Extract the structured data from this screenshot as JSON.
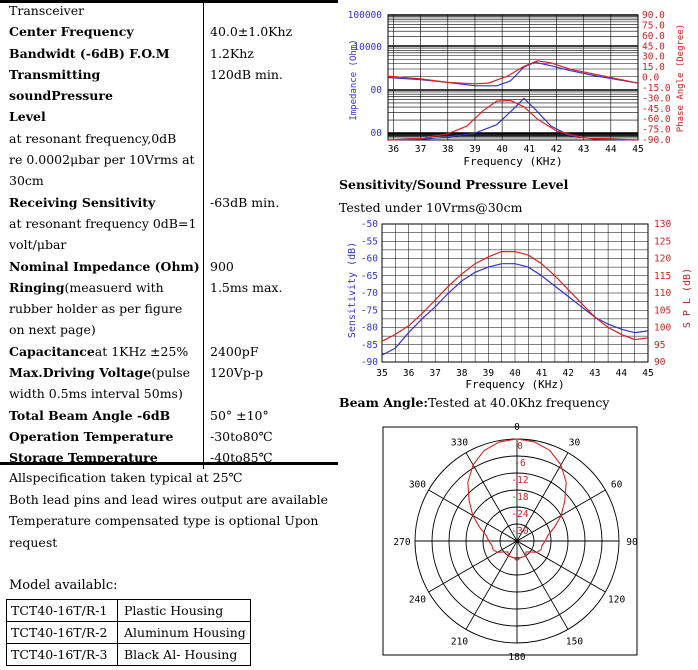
{
  "spec": {
    "rows": [
      {
        "k": "Transceiver",
        "kb": false,
        "v": "",
        "kcont": []
      },
      {
        "k": "Center Frequency",
        "kb": true,
        "v": "40.0±1.0Khz",
        "kcont": []
      },
      {
        "k": "Bandwidt (-6dB)   F.O.M",
        "kb": true,
        "v": "1.2Khz",
        "kcont": []
      },
      {
        "k": "Transmitting soundPressure",
        "kb": true,
        "v": "120dB min.",
        "kcont": []
      },
      {
        "k": "Level",
        "kb": true,
        "v": "",
        "kcont": []
      },
      {
        "k": "at resonant frequency,0dB",
        "kb": false,
        "v": "",
        "kcont": []
      },
      {
        "k": "re 0.0002μbar per 10Vrms at",
        "kb": false,
        "v": "",
        "kcont": []
      },
      {
        "k": "30cm",
        "kb": false,
        "v": "",
        "kcont": []
      },
      {
        "k": "Receiving Sensitivity",
        "kb": true,
        "v": "-63dB min.",
        "kcont": []
      },
      {
        "k": "at resonant frequency 0dB=1",
        "kb": false,
        "v": "",
        "kcont": []
      },
      {
        "k": "volt/μbar",
        "kb": false,
        "v": "",
        "kcont": []
      },
      {
        "k": "Nominal Impedance (Ohm)",
        "kb": true,
        "v": "900",
        "kcont": []
      },
      {
        "k": "Ringing",
        "kb": true,
        "kextra": "(measuerd with",
        "v": "1.5ms max.",
        "kcont": []
      },
      {
        "k": "rubber holder as per figure",
        "kb": false,
        "v": "",
        "kcont": []
      },
      {
        "k": "on next page)",
        "kb": false,
        "v": "",
        "kcont": []
      },
      {
        "k": "Capacitance",
        "kb": true,
        "kextra": "at 1KHz   ±25%",
        "v": "2400pF",
        "kcont": []
      },
      {
        "k": "Max.Driving Voltage",
        "kb": true,
        "kextra": "(pulse",
        "v": "120Vp-p",
        "kcont": []
      },
      {
        "k": "width 0.5ms interval 50ms)",
        "kb": false,
        "v": "",
        "kcont": []
      },
      {
        "k": "Total Beam Angle   -6dB",
        "kb": true,
        "v": "50°  ±10°",
        "kcont": []
      },
      {
        "k": "Operation Temperature",
        "kb": true,
        "v": "-30to80℃",
        "kcont": []
      },
      {
        "k": "Storage Temperature",
        "kb": true,
        "v": "-40to85℃",
        "kcont": []
      }
    ]
  },
  "notes": [
    "Allspecification taken typical at 25℃",
    "Both lead pins and lead wires output are available",
    "Temperature compensated type is optional Upon",
    "request"
  ],
  "models": {
    "title": "Model availablc:",
    "rows": [
      [
        "TCT40-16T/R-1",
        "Plastic  Housing"
      ],
      [
        "TCT40-16T/R-2",
        "Aluminum  Housing"
      ],
      [
        "TCT40-16T/R-3",
        "Black Al- Housing"
      ]
    ]
  },
  "headings": {
    "sensitivity_title": "Sensitivity/Sound Pressure Level",
    "sensitivity_sub": "Tested under 10Vrms@30cm",
    "beam_bold": "Beam Angle:",
    "beam_text": "Tested at 40.0Khz frequency"
  },
  "colors": {
    "blue": "#3333cc",
    "red": "#dd2222",
    "axis_red": "#cc2222"
  },
  "chart_data": [
    {
      "type": "line",
      "xlabel": "Frequency   (KHz)",
      "ylabel_left": "Impedance (Ohm)",
      "ylabel_right": "Phase Angle (Degree)",
      "x_ticks": [
        "36",
        "37",
        "38",
        "39",
        "40",
        "41",
        "42",
        "43",
        "44",
        "45"
      ],
      "xlim": [
        35.8,
        45
      ],
      "y_left_ticks": [
        "100000",
        "10000",
        "00",
        "00"
      ],
      "y_right_ticks": [
        "90.0",
        "75.0",
        "60.0",
        "45.0",
        "30.0",
        "15.0",
        "0.0",
        "-15.0",
        "-30.0",
        "-45.0",
        "-60.0",
        "-75.0",
        "-90.0"
      ],
      "ylim_right": [
        -90,
        90
      ],
      "series": [
        {
          "axis": "right",
          "color": "blue",
          "points": [
            [
              35.8,
              0
            ],
            [
              37,
              -3
            ],
            [
              38,
              -7
            ],
            [
              39,
              -12
            ],
            [
              39.8,
              -12
            ],
            [
              40.3,
              -5
            ],
            [
              40.8,
              15
            ],
            [
              41.2,
              22
            ],
            [
              41.8,
              17
            ],
            [
              42.5,
              10
            ],
            [
              43.5,
              2
            ],
            [
              45,
              -8
            ]
          ]
        },
        {
          "axis": "right",
          "color": "red",
          "points": [
            [
              35.8,
              2
            ],
            [
              37,
              -2
            ],
            [
              38,
              -7
            ],
            [
              39,
              -9
            ],
            [
              39.5,
              -8
            ],
            [
              40.2,
              2
            ],
            [
              40.8,
              16
            ],
            [
              41.3,
              24
            ],
            [
              41.8,
              21
            ],
            [
              42.5,
              12
            ],
            [
              43.5,
              4
            ],
            [
              45,
              -8
            ]
          ]
        },
        {
          "axis": "right",
          "color": "blue",
          "points": [
            [
              35.8,
              -90
            ],
            [
              37,
              -89
            ],
            [
              38,
              -86
            ],
            [
              39,
              -80
            ],
            [
              39.8,
              -68
            ],
            [
              40.4,
              -46
            ],
            [
              40.8,
              -30
            ],
            [
              41.2,
              -45
            ],
            [
              41.8,
              -70
            ],
            [
              42.5,
              -84
            ],
            [
              43.5,
              -89
            ],
            [
              45,
              -90
            ]
          ]
        },
        {
          "axis": "right",
          "color": "red",
          "points": [
            [
              35.8,
              -90
            ],
            [
              37,
              -88
            ],
            [
              38,
              -81
            ],
            [
              38.7,
              -70
            ],
            [
              39.3,
              -48
            ],
            [
              39.8,
              -34
            ],
            [
              40.3,
              -33
            ],
            [
              40.8,
              -42
            ],
            [
              41.3,
              -60
            ],
            [
              42,
              -77
            ],
            [
              43,
              -87
            ],
            [
              45,
              -90
            ]
          ]
        }
      ]
    },
    {
      "type": "line",
      "xlabel": "Frequency  (KHz)",
      "ylabel_left": "Sensitivity (dB)",
      "ylabel_right": "S P L (dB)",
      "x_ticks": [
        "35",
        "36",
        "37",
        "38",
        "39",
        "40",
        "41",
        "42",
        "43",
        "44",
        "45"
      ],
      "xlim": [
        35,
        45
      ],
      "y_left_ticks": [
        "-50",
        "-55",
        "-60",
        "-65",
        "-70",
        "-75",
        "-80",
        "-85",
        "-90"
      ],
      "ylim_left": [
        -90,
        -50
      ],
      "y_right_ticks": [
        "130",
        "125",
        "120",
        "115",
        "110",
        "105",
        "100",
        "95",
        "90"
      ],
      "ylim_right": [
        90,
        130
      ],
      "series": [
        {
          "name": "",
          "axis": "left",
          "color": "blue",
          "points": [
            [
              35,
              -88
            ],
            [
              35.5,
              -86
            ],
            [
              36,
              -81.5
            ],
            [
              36.5,
              -77.5
            ],
            [
              37,
              -74
            ],
            [
              37.5,
              -70
            ],
            [
              38,
              -66.5
            ],
            [
              38.5,
              -64
            ],
            [
              39,
              -62.5
            ],
            [
              39.5,
              -61.5
            ],
            [
              40,
              -61.5
            ],
            [
              40.5,
              -62.5
            ],
            [
              41,
              -65
            ],
            [
              41.5,
              -68
            ],
            [
              42,
              -71
            ],
            [
              42.5,
              -74
            ],
            [
              43,
              -77
            ],
            [
              43.5,
              -79
            ],
            [
              44,
              -80.5
            ],
            [
              44.5,
              -81.5
            ],
            [
              45,
              -81
            ]
          ]
        },
        {
          "name": "",
          "axis": "right",
          "color": "red",
          "points": [
            [
              35,
              96
            ],
            [
              35.5,
              98
            ],
            [
              36,
              100.5
            ],
            [
              36.5,
              104
            ],
            [
              37,
              108
            ],
            [
              37.5,
              112
            ],
            [
              38,
              115.5
            ],
            [
              38.5,
              118.5
            ],
            [
              39,
              120.5
            ],
            [
              39.5,
              122
            ],
            [
              40,
              122
            ],
            [
              40.5,
              121
            ],
            [
              41,
              118.5
            ],
            [
              41.5,
              115
            ],
            [
              42,
              111
            ],
            [
              42.5,
              107
            ],
            [
              43,
              103
            ],
            [
              43.5,
              100
            ],
            [
              44,
              98
            ],
            [
              44.5,
              96.5
            ],
            [
              45,
              97
            ]
          ]
        }
      ]
    },
    {
      "type": "polar",
      "angle_ticks": [
        "0",
        "30",
        "60",
        "90",
        "120",
        "150",
        "180",
        "210",
        "240",
        "270",
        "300",
        "330"
      ],
      "radial_ticks": [
        "0",
        "-6",
        "-12",
        "-18",
        "-24",
        "-30"
      ],
      "series": [
        {
          "name": "",
          "color": "red",
          "angles": [
            0,
            10,
            20,
            30,
            40,
            50,
            60,
            70,
            80,
            90,
            100,
            110,
            120,
            130,
            140,
            150,
            160,
            170,
            180
          ],
          "values": [
            0,
            -0.5,
            -2,
            -5,
            -9,
            -14,
            -18,
            -22,
            -25,
            -26,
            -27,
            -27,
            -28,
            -30,
            -31,
            -30,
            -30,
            -30,
            -29
          ]
        }
      ]
    }
  ]
}
